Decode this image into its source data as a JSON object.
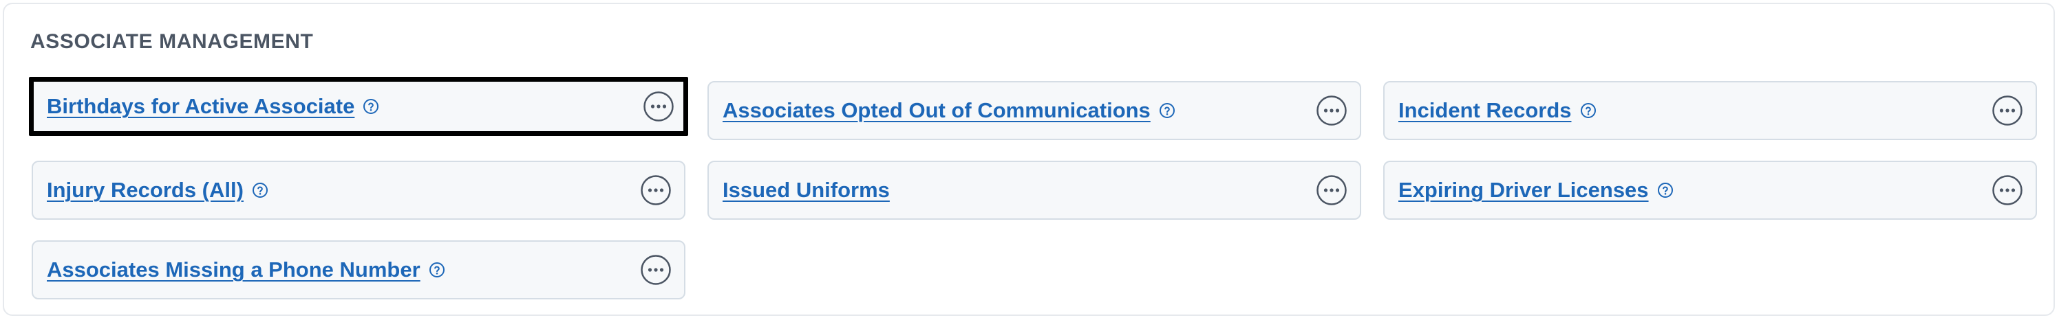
{
  "section": {
    "title": "ASSOCIATE MANAGEMENT"
  },
  "reports": [
    {
      "label": "Birthdays for Active Associate ",
      "has_help": true,
      "highlighted": true
    },
    {
      "label": "Associates Opted Out of Communications ",
      "has_help": true,
      "highlighted": false
    },
    {
      "label": "Incident Records ",
      "has_help": true,
      "highlighted": false
    },
    {
      "label": "Injury Records (All) ",
      "has_help": true,
      "highlighted": false
    },
    {
      "label": "Issued Uniforms",
      "has_help": false,
      "highlighted": false
    },
    {
      "label": "Expiring Driver Licenses ",
      "has_help": true,
      "highlighted": false
    },
    {
      "label": "Associates Missing a Phone Number ",
      "has_help": true,
      "highlighted": false
    }
  ],
  "icons": {
    "help": "question-circle-icon",
    "more": "more-options-icon"
  },
  "colors": {
    "link": "#1d67b8",
    "card_bg": "#f6f8fa",
    "card_border": "#d5dde5",
    "highlight_border": "#000000",
    "title": "#4b5563"
  }
}
